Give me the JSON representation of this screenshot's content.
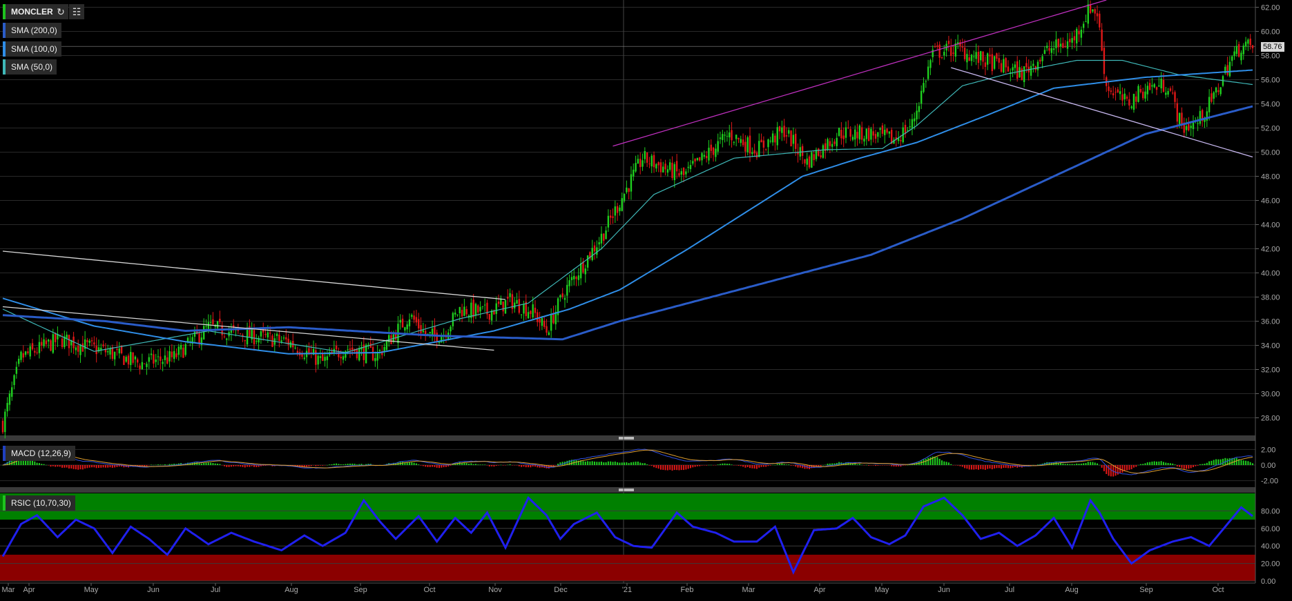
{
  "symbol": "MONCLER",
  "indicators": {
    "sma200": "SMA (200,0)",
    "sma100": "SMA (100,0)",
    "sma50": "SMA (50,0)",
    "macd": "MACD (12,26,9)",
    "rsi": "RSIC (10,70,30)"
  },
  "toolbar": {
    "refresh_icon": "refresh-icon",
    "calendar_icon": "calendar-icon"
  },
  "last_price": "58.76",
  "colors": {
    "up": "#1fd01f",
    "down": "#e01818",
    "sma50": "#3fb8b8",
    "sma100": "#2f8ee8",
    "sma200": "#2a5cc8",
    "trend_upper": "#c030c0",
    "trend_lower": "#c8b8f0",
    "rsi_line": "#2020ee",
    "rsi_over": "#008000",
    "rsi_under": "#8b0000",
    "macd_line": "#3050e0",
    "macd_signal": "#e0a030"
  },
  "chart_data": {
    "type": "candlestick",
    "title": "MONCLER",
    "x_months": [
      "Mar",
      "Apr",
      "May",
      "Jun",
      "Jul",
      "Aug",
      "Sep",
      "Oct",
      "Nov",
      "Dec",
      "'21",
      "Feb",
      "Mar",
      "Apr",
      "May",
      "Jun",
      "Jul",
      "Aug",
      "Sep",
      "Oct"
    ],
    "price_axis": {
      "ylim": [
        26.6,
        62.6
      ],
      "ticks": [
        "28.00",
        "30.00",
        "32.00",
        "34.00",
        "36.00",
        "38.00",
        "40.00",
        "42.00",
        "44.00",
        "46.00",
        "48.00",
        "50.00",
        "52.00",
        "54.00",
        "56.00",
        "58.00",
        "60.00",
        "62.00"
      ]
    },
    "close_path": [
      [
        0,
        27.5
      ],
      [
        8,
        33
      ],
      [
        25,
        34.5
      ],
      [
        45,
        33.5
      ],
      [
        60,
        32.5
      ],
      [
        75,
        33
      ],
      [
        90,
        35.5
      ],
      [
        108,
        34.8
      ],
      [
        125,
        34.3
      ],
      [
        140,
        32.6
      ],
      [
        150,
        33.8
      ],
      [
        164,
        33.2
      ],
      [
        178,
        36.5
      ],
      [
        186,
        34.7
      ],
      [
        193,
        35
      ],
      [
        200,
        37
      ],
      [
        212,
        36.7
      ],
      [
        222,
        37.7
      ],
      [
        232,
        36.8
      ],
      [
        238,
        35.2
      ],
      [
        246,
        38.5
      ],
      [
        262,
        43
      ],
      [
        280,
        49.5
      ],
      [
        298,
        48
      ],
      [
        318,
        51.5
      ],
      [
        330,
        50.2
      ],
      [
        342,
        51.8
      ],
      [
        352,
        49.2
      ],
      [
        366,
        51.6
      ],
      [
        380,
        51.5
      ],
      [
        390,
        51
      ],
      [
        398,
        52.3
      ],
      [
        407,
        58.2
      ],
      [
        418,
        58.6
      ],
      [
        426,
        57.8
      ],
      [
        436,
        57.2
      ],
      [
        446,
        56.5
      ],
      [
        458,
        58.5
      ],
      [
        468,
        59.2
      ],
      [
        476,
        62
      ],
      [
        479,
        61.5
      ],
      [
        483,
        55.5
      ],
      [
        492,
        54
      ],
      [
        500,
        55.3
      ],
      [
        510,
        55.6
      ],
      [
        516,
        52
      ],
      [
        523,
        52.5
      ],
      [
        530,
        54.5
      ],
      [
        537,
        57.5
      ],
      [
        542,
        58.8
      ],
      [
        547,
        58.7
      ]
    ],
    "sma50": [
      [
        0,
        37
      ],
      [
        40,
        33.5
      ],
      [
        90,
        35.2
      ],
      [
        150,
        33.4
      ],
      [
        200,
        36.2
      ],
      [
        230,
        37.5
      ],
      [
        262,
        42
      ],
      [
        285,
        46.5
      ],
      [
        320,
        49.5
      ],
      [
        360,
        50.2
      ],
      [
        385,
        50.3
      ],
      [
        400,
        52.2
      ],
      [
        420,
        55.5
      ],
      [
        440,
        56.5
      ],
      [
        470,
        57.6
      ],
      [
        490,
        57.6
      ],
      [
        515,
        56.4
      ],
      [
        547,
        55.6
      ]
    ],
    "sma100": [
      [
        0,
        37.9
      ],
      [
        40,
        35.6
      ],
      [
        80,
        34.3
      ],
      [
        125,
        33.3
      ],
      [
        165,
        33.4
      ],
      [
        215,
        35.2
      ],
      [
        248,
        37
      ],
      [
        270,
        38.6
      ],
      [
        300,
        42
      ],
      [
        350,
        48
      ],
      [
        375,
        49.5
      ],
      [
        400,
        50.8
      ],
      [
        430,
        53
      ],
      [
        460,
        55.3
      ],
      [
        500,
        56.2
      ],
      [
        547,
        56.8
      ]
    ],
    "sma200": [
      [
        0,
        36.5
      ],
      [
        45,
        36
      ],
      [
        80,
        35.2
      ],
      [
        125,
        35.5
      ],
      [
        190,
        34.8
      ],
      [
        245,
        34.5
      ],
      [
        270,
        36
      ],
      [
        300,
        37.5
      ],
      [
        340,
        39.5
      ],
      [
        380,
        41.5
      ],
      [
        420,
        44.5
      ],
      [
        460,
        48
      ],
      [
        500,
        51.5
      ],
      [
        547,
        53.8
      ]
    ],
    "trendlines": [
      {
        "name": "upper-resistance",
        "color": "trend_upper",
        "points": [
          [
            267,
            50.5
          ],
          [
            483,
            62.6
          ]
        ]
      },
      {
        "name": "lower-support",
        "color": "trend_lower",
        "points": [
          [
            415,
            57
          ],
          [
            547,
            49.6
          ]
        ]
      },
      {
        "name": "old-downtrend",
        "color": "#d8d8d8",
        "points": [
          [
            0,
            41.8
          ],
          [
            220,
            37.8
          ]
        ]
      },
      {
        "name": "old-support",
        "color": "#d8d8d8",
        "points": [
          [
            0,
            37.2
          ],
          [
            215,
            33.6
          ]
        ]
      }
    ],
    "macd": {
      "ylim": [
        -3,
        3
      ],
      "ticks": [
        "2.00",
        "0.00",
        "-2.00"
      ]
    },
    "rsi": {
      "ylim": [
        0,
        100
      ],
      "overbought": 70,
      "oversold": 30,
      "ticks": [
        "80.00",
        "60.00",
        "40.00",
        "20.00",
        "0.00"
      ],
      "path": [
        [
          0,
          28
        ],
        [
          8,
          65
        ],
        [
          15,
          75
        ],
        [
          24,
          50
        ],
        [
          32,
          70
        ],
        [
          40,
          60
        ],
        [
          48,
          32
        ],
        [
          56,
          62
        ],
        [
          64,
          48
        ],
        [
          72,
          30
        ],
        [
          80,
          60
        ],
        [
          90,
          42
        ],
        [
          100,
          55
        ],
        [
          110,
          45
        ],
        [
          122,
          35
        ],
        [
          132,
          52
        ],
        [
          140,
          40
        ],
        [
          150,
          55
        ],
        [
          158,
          92
        ],
        [
          165,
          68
        ],
        [
          172,
          48
        ],
        [
          182,
          74
        ],
        [
          190,
          45
        ],
        [
          198,
          72
        ],
        [
          205,
          55
        ],
        [
          212,
          78
        ],
        [
          220,
          38
        ],
        [
          230,
          95
        ],
        [
          238,
          75
        ],
        [
          244,
          48
        ],
        [
          250,
          65
        ],
        [
          260,
          78
        ],
        [
          268,
          50
        ],
        [
          276,
          40
        ],
        [
          284,
          38
        ],
        [
          295,
          78
        ],
        [
          302,
          62
        ],
        [
          312,
          55
        ],
        [
          320,
          45
        ],
        [
          330,
          45
        ],
        [
          338,
          62
        ],
        [
          346,
          10
        ],
        [
          355,
          58
        ],
        [
          365,
          60
        ],
        [
          372,
          72
        ],
        [
          380,
          50
        ],
        [
          388,
          42
        ],
        [
          395,
          52
        ],
        [
          403,
          85
        ],
        [
          412,
          95
        ],
        [
          420,
          75
        ],
        [
          428,
          48
        ],
        [
          436,
          55
        ],
        [
          444,
          40
        ],
        [
          452,
          52
        ],
        [
          460,
          72
        ],
        [
          468,
          38
        ],
        [
          476,
          92
        ],
        [
          480,
          78
        ],
        [
          486,
          48
        ],
        [
          494,
          20
        ],
        [
          502,
          35
        ],
        [
          512,
          45
        ],
        [
          520,
          50
        ],
        [
          528,
          40
        ],
        [
          535,
          62
        ],
        [
          542,
          84
        ],
        [
          547,
          74
        ]
      ]
    }
  }
}
